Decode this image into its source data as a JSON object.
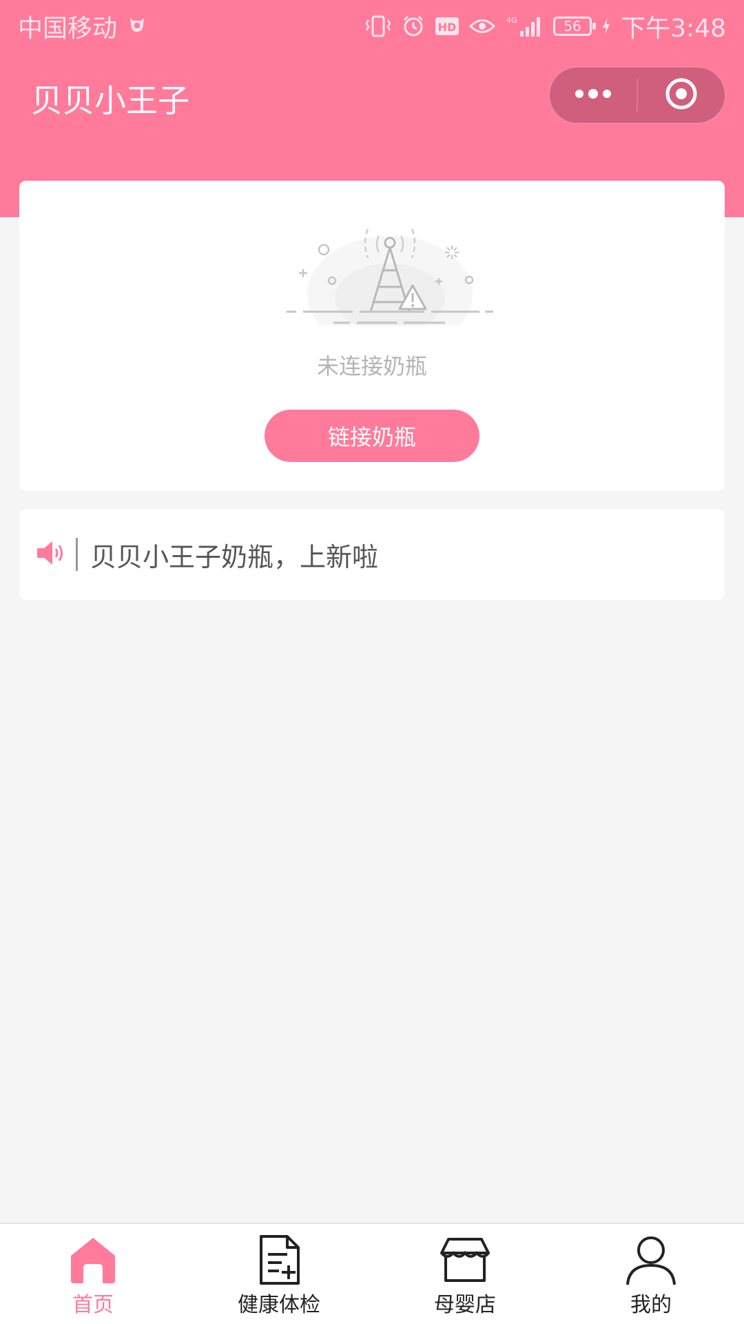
{
  "status_bar": {
    "carrier": "中国移动",
    "network": "4G",
    "battery": "56",
    "time": "下午3:48"
  },
  "header": {
    "title": "贝贝小王子"
  },
  "device_card": {
    "status": "未连接奶瓶",
    "connect_label": "链接奶瓶"
  },
  "notice": {
    "text": "贝贝小王子奶瓶，上新啦"
  },
  "tabbar": {
    "active_index": 0,
    "items": [
      {
        "label": "首页",
        "icon": "home-icon"
      },
      {
        "label": "健康体检",
        "icon": "health-check-icon"
      },
      {
        "label": "母婴店",
        "icon": "store-icon"
      },
      {
        "label": "我的",
        "icon": "profile-icon"
      }
    ]
  },
  "colors": {
    "accent": "#ff7a9b",
    "capsule": "#cf5f7d",
    "background": "#f5f5f5"
  }
}
